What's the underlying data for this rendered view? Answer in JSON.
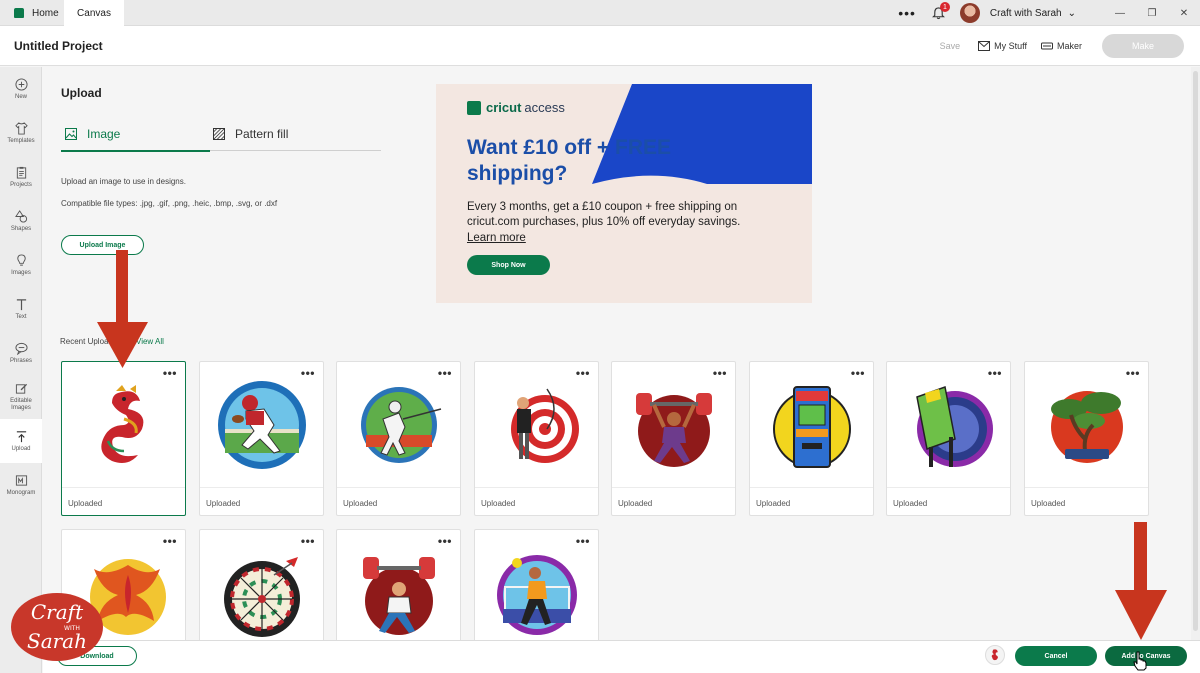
{
  "topbar": {
    "tabs": [
      "Home",
      "Canvas"
    ],
    "notification_count": "1",
    "account_name": "Craft with Sarah"
  },
  "header": {
    "project_title": "Untitled Project",
    "save_label": "Save",
    "my_stuff_label": "My Stuff",
    "machine_label": "Maker",
    "make_label": "Make"
  },
  "sidebar": {
    "items": [
      {
        "label": "New",
        "icon": "plus-circle-icon"
      },
      {
        "label": "Templates",
        "icon": "shirt-icon"
      },
      {
        "label": "Projects",
        "icon": "clipboard-icon"
      },
      {
        "label": "Shapes",
        "icon": "shapes-icon"
      },
      {
        "label": "Images",
        "icon": "lightbulb-icon"
      },
      {
        "label": "Text",
        "icon": "text-icon"
      },
      {
        "label": "Phrases",
        "icon": "speech-bubble-icon"
      },
      {
        "label": "Editable Images",
        "icon": "edit-image-icon"
      },
      {
        "label": "Upload",
        "icon": "upload-icon"
      },
      {
        "label": "Monogram",
        "icon": "monogram-icon"
      }
    ],
    "active": "Upload"
  },
  "upload_panel": {
    "title": "Upload",
    "tabs": {
      "image": "Image",
      "pattern": "Pattern fill"
    },
    "description": "Upload an image to use in designs.",
    "file_types": "Compatible file types: .jpg, .gif, .png, .heic, .bmp, .svg, or .dxf",
    "upload_button": "Upload Image",
    "recent_label": "Recent Uploads",
    "view_all": "View All"
  },
  "ad": {
    "brand": "cricut",
    "brand_suffix": "access",
    "headline": "Want £10 off + FREE shipping?",
    "body": "Every 3 months, get a £10 coupon + free shipping on cricut.com purchases, plus 10% off everyday savings.",
    "link": "Learn more",
    "button": "Shop Now",
    "colors": {
      "blue": "#1a46c8",
      "green": "#0b7a4b",
      "bg": "#f3e7e1"
    }
  },
  "uploads": [
    {
      "caption": "Uploaded",
      "subject": "dragon",
      "selected": true
    },
    {
      "caption": "Uploaded",
      "subject": "american-football-player"
    },
    {
      "caption": "Uploaded",
      "subject": "fencer"
    },
    {
      "caption": "Uploaded",
      "subject": "archer"
    },
    {
      "caption": "Uploaded",
      "subject": "weightlifter"
    },
    {
      "caption": "Uploaded",
      "subject": "arcade-machine"
    },
    {
      "caption": "Uploaded",
      "subject": "pinball-machine"
    },
    {
      "caption": "Uploaded",
      "subject": "bonsai-tree"
    },
    {
      "caption": "",
      "subject": "phoenix"
    },
    {
      "caption": "",
      "subject": "dartboard"
    },
    {
      "caption": "",
      "subject": "weightlifter-2"
    },
    {
      "caption": "",
      "subject": "handball-player"
    }
  ],
  "bottombar": {
    "download_label": "Download",
    "cancel_label": "Cancel",
    "add_label": "Add to Canvas"
  },
  "watermark": {
    "line1": "Craft",
    "line2": "WITH",
    "line3": "Sarah"
  }
}
